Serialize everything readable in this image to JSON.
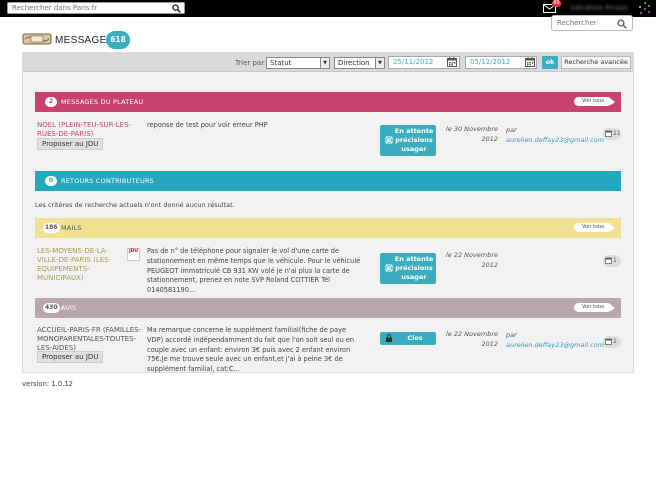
{
  "top": {
    "search_placeholder": "Rechercher dans Paris.fr",
    "mail_count": "69",
    "username": "Salvatore Pirozzi"
  },
  "header": {
    "title": "MESSAGES",
    "count": "618",
    "search_placeholder": "Rechercher"
  },
  "filters": {
    "trier_par": "Trier par",
    "statut": "Statut",
    "direction": "Direction",
    "date_from": "25/11/2012",
    "date_to": "05/12/2012",
    "ok": "ok",
    "advanced": "Recherche avancée"
  },
  "sections": {
    "plateau": {
      "count": "2",
      "title": "MESSAGES DU PLATEAU",
      "voir": "Voir tous",
      "color": "#c9426f"
    },
    "contrib": {
      "count": "0",
      "title": "RETOURS CONTRIBUTEURS",
      "color": "#23a9bf"
    },
    "mails": {
      "count": "186",
      "title": "MAILS",
      "voir": "Voir tous",
      "color": "#f0e292"
    },
    "avis": {
      "count": "430",
      "title": "AVIS",
      "voir": "Voir tous",
      "color": "#b8a8ad"
    }
  },
  "no_result": "Les critères de recherche actuels n'ont donné aucun résultat.",
  "rows": [
    {
      "title": "NOEL (PLEIN-TEU-SUR-LES-RUES-DE-PARIS)",
      "propose": "Proposer au JDU",
      "text": "reponse de test pour voir erreur PHP",
      "status": "En attente précisions usager",
      "date_line1": "le 30 Novembre",
      "date_line2": "2012",
      "par": "par",
      "email": "aurelien.deffay23@gmail.com",
      "comments": "11",
      "title_color": "#c9426f"
    },
    {
      "title": "LES-MOYENS-DE-LA-VILLE-DE-PARIS (LES-EQUIPEMENTS-MUNICIPAUX)",
      "jdu": "JDU",
      "text": "Pas de n° de téléphone pour signaler le vol d'une carte de stationnement en même temps que le véhicule. Pour le véhicule PEUGEOT immatriculé CB 931 KW volé je n'ai plus la carte de stationnement, prenez en note SVP Roland COTTIER Tél 0140581190...",
      "status": "En attente précisions usager",
      "date_line1": "le 22 Novembre",
      "date_line2": "2012",
      "comments": "1",
      "title_color": "#a69a4d"
    },
    {
      "title": "ACCUEIL-PARIS-FR (FAMILLES-MONOPARENTALES-TOUTES-LES-AIDES)",
      "propose": "Proposer au JDU",
      "text": "Ma remarque concerne le supplément familial(fiche de paye VDP) accordé indépendamment du fait que l'on soit seul ou en couple avec un enfant: environ 3€ puis avec 2 enfant environ 75€.Je me trouve seule avec un enfant,et j'ai à peine 3€ de supplément familial, cat:C...",
      "status": "Clos",
      "date_line1": "le 22 Novembre",
      "date_line2": "2012",
      "par": "par",
      "email": "aurelien.deffay23@gmail.com",
      "comments": "1",
      "title_color": "#555555"
    }
  ],
  "version": "version: 1.0.12"
}
